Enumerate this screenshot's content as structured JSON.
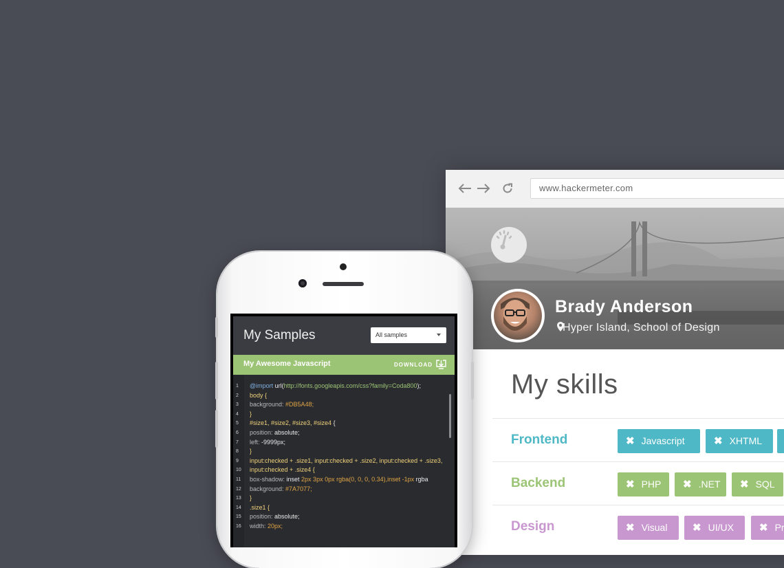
{
  "browser": {
    "url": "www.hackermeter.com",
    "nav": {
      "back_icon": "arrow-left-icon",
      "forward_icon": "arrow-right-icon",
      "reload_icon": "reload-icon"
    }
  },
  "profile": {
    "name": "Brady Anderson",
    "location": "Hyper Island, School of Design",
    "logo_icon": "gauge-icon",
    "location_icon": "map-pin-icon"
  },
  "skills": {
    "title": "My skills",
    "groups": [
      {
        "label": "Frontend",
        "color": "#4fb8c6",
        "tags": [
          "Javascript",
          "XHTML",
          ""
        ]
      },
      {
        "label": "Backend",
        "color": "#9cc475",
        "tags": [
          "PHP",
          ".NET",
          "SQL"
        ]
      },
      {
        "label": "Design",
        "color": "#c897cf",
        "tags": [
          "Visual",
          "UI/UX",
          "Pr"
        ]
      }
    ]
  },
  "phone_app": {
    "title": "My Samples",
    "filter": "All samples",
    "sample_name": "My Awesome Javascript",
    "download_label": "DOWNLOAD",
    "code": [
      {
        "n": "1",
        "segs": [
          [
            "@import",
            "#7fb0e0"
          ],
          [
            " url(",
            "#e9e9e9"
          ],
          [
            "http://fonts.googleapis.com/css?family=Coda800",
            "#9cc475"
          ],
          [
            ");",
            "#e9e9e9"
          ]
        ]
      },
      {
        "n": "2",
        "segs": [
          [
            "body {",
            "#f0d27a"
          ]
        ]
      },
      {
        "n": "3",
        "segs": [
          [
            "background: ",
            "#b9b9b9"
          ],
          [
            "#DB5A48;",
            "#e0a545"
          ]
        ]
      },
      {
        "n": "4",
        "segs": [
          [
            "}",
            "#f0d27a"
          ]
        ]
      },
      {
        "n": "5",
        "segs": [
          [
            "#size1, #size2, #size3, #size4",
            "#f0d27a"
          ],
          [
            " {",
            "#e9e9e9"
          ]
        ]
      },
      {
        "n": "6",
        "segs": [
          [
            "position: ",
            "#b9b9b9"
          ],
          [
            "absolute;",
            "#e9e9e9"
          ]
        ]
      },
      {
        "n": "7",
        "segs": [
          [
            "left: ",
            "#b9b9b9"
          ],
          [
            "-9999px;",
            "#e9e9e9"
          ]
        ]
      },
      {
        "n": "8",
        "segs": [
          [
            "}",
            "#f0d27a"
          ]
        ]
      },
      {
        "n": "9",
        "segs": [
          [
            "input:checked + .size1, input:checked + .size2, input:checked + .size3,",
            "#f0d27a"
          ]
        ]
      },
      {
        "n": "10",
        "segs": [
          [
            "input:checked + .size4 {",
            "#f0d27a"
          ]
        ]
      },
      {
        "n": "11",
        "segs": [
          [
            "box-shadow: ",
            "#b9b9b9"
          ],
          [
            "inset ",
            "#e9e9e9"
          ],
          [
            "2px 3px 0px rgba(0, 0, 0, 0.34),inset -1px",
            "#e0a545"
          ],
          [
            " rgba",
            "#e9e9e9"
          ]
        ]
      },
      {
        "n": "12",
        "segs": [
          [
            "background: ",
            "#b9b9b9"
          ],
          [
            "#7A7077;",
            "#e0a545"
          ]
        ]
      },
      {
        "n": "13",
        "segs": [
          [
            "}",
            "#f0d27a"
          ]
        ]
      },
      {
        "n": "14",
        "segs": [
          [
            ".size1 {",
            "#f0d27a"
          ]
        ]
      },
      {
        "n": "15",
        "segs": [
          [
            "position: ",
            "#b9b9b9"
          ],
          [
            "absolute;",
            "#e9e9e9"
          ]
        ]
      },
      {
        "n": "16",
        "segs": [
          [
            "width: ",
            "#b9b9b9"
          ],
          [
            "20px;",
            "#e0a545"
          ]
        ]
      }
    ]
  }
}
